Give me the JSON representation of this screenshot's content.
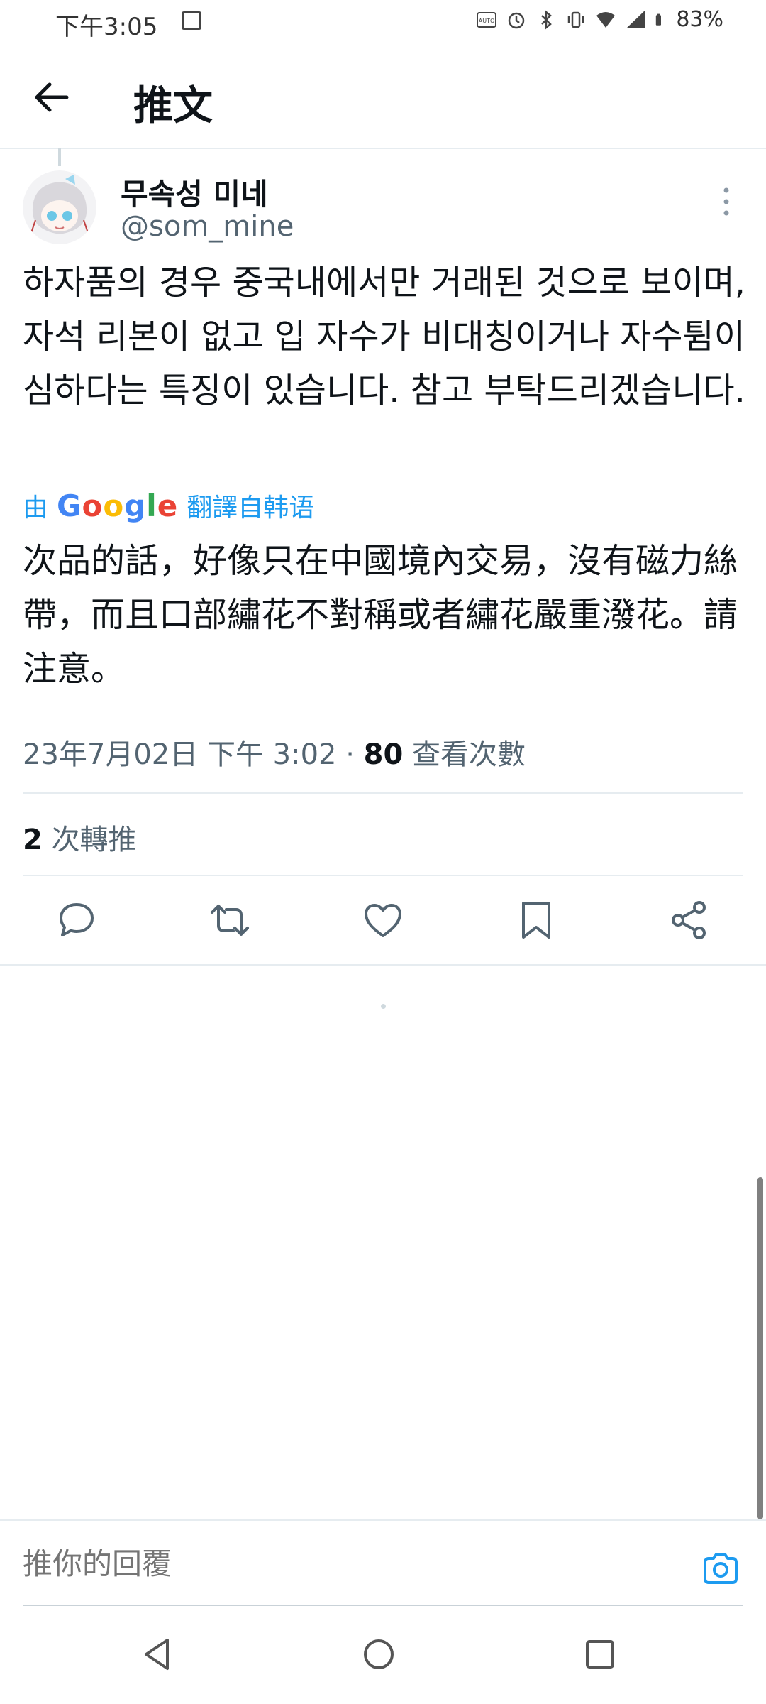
{
  "status_bar": {
    "time": "下午3:05",
    "battery": "83%"
  },
  "header": {
    "title": "推文"
  },
  "tweet": {
    "display_name": "무속성 미네",
    "handle": "@som_mine",
    "text": "하자품의 경우 중국내에서만 거래된 것으로 보이며, 자석 리본이 없고 입 자수가 비대칭이거나 자수튐이 심하다는 특징이 있습니다. 참고 부탁드리겠습니다.",
    "translate_prefix": "由",
    "translate_brand": "Google",
    "translate_suffix": "翻譯自韩语",
    "translated_text": "次品的話，好像只在中國境內交易，沒有磁力絲帶，而且口部繡花不對稱或者繡花嚴重潑花。請注意。",
    "timestamp": "23年7月02日 下午 3:02",
    "separator": "·",
    "views_count": "80",
    "views_label": "查看次數",
    "retweets_count": "2",
    "retweets_label": "次轉推"
  },
  "reply": {
    "placeholder": "推你的回覆"
  },
  "colors": {
    "accent": "#1d9bf0",
    "text": "#0f1419",
    "secondary": "#536471"
  }
}
